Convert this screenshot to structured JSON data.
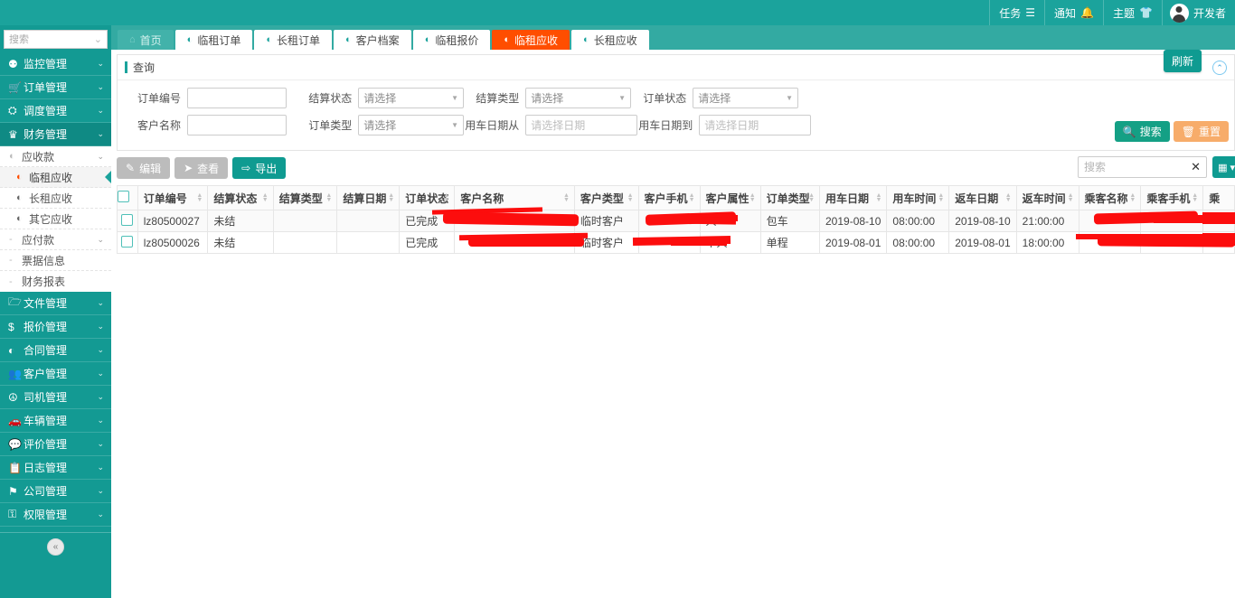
{
  "topbar": {
    "items": [
      {
        "label": "任务",
        "icon": "task-list-icon",
        "glyph": "☰"
      },
      {
        "label": "通知",
        "icon": "bell-icon",
        "glyph": "🔔"
      },
      {
        "label": "主题",
        "icon": "shirt-icon",
        "glyph": "👕"
      }
    ],
    "user": "开发者"
  },
  "sidebar": {
    "search_placeholder": "搜索",
    "chevron": "⌄",
    "collapse_glyph": "«",
    "menu": [
      {
        "label": "监控管理",
        "icon": "binoculars-icon",
        "glyph": "⚉",
        "arrow": "⌄"
      },
      {
        "label": "订单管理",
        "icon": "cart-icon",
        "glyph": "🛒",
        "arrow": "⌄"
      },
      {
        "label": "调度管理",
        "icon": "sitemap-icon",
        "glyph": "⛭",
        "arrow": "⌄"
      },
      {
        "label": "财务管理",
        "icon": "trophy-icon",
        "glyph": "♛",
        "arrow": "⌄",
        "open": true
      }
    ],
    "finance_children": [
      {
        "label": "应收款",
        "icon": "circle-half-icon",
        "glyph": "◐",
        "arrow": "⌄",
        "type": "group"
      },
      {
        "label": "临租应收",
        "icon": "circle-half-icon",
        "glyph": "◐",
        "type": "leaf",
        "active": true
      },
      {
        "label": "长租应收",
        "icon": "circle-half-icon",
        "glyph": "◐",
        "type": "leaf"
      },
      {
        "label": "其它应收",
        "icon": "circle-half-icon",
        "glyph": "◐",
        "type": "leaf"
      },
      {
        "label": "应付款",
        "icon": "dash-icon",
        "glyph": "-",
        "arrow": "⌄",
        "type": "group2"
      },
      {
        "label": "票据信息",
        "icon": "dash-icon",
        "glyph": "-",
        "type": "group2"
      },
      {
        "label": "财务报表",
        "icon": "dash-icon",
        "glyph": "-",
        "type": "group2"
      }
    ],
    "menu2": [
      {
        "label": "文件管理",
        "icon": "folder-icon",
        "glyph": "🗁",
        "arrow": "⌄"
      },
      {
        "label": "报价管理",
        "icon": "dollar-icon",
        "glyph": "$",
        "arrow": "⌄"
      },
      {
        "label": "合同管理",
        "icon": "circle-half-icon",
        "glyph": "◐",
        "arrow": "⌄"
      },
      {
        "label": "客户管理",
        "icon": "users-icon",
        "glyph": "👥",
        "arrow": "⌄"
      },
      {
        "label": "司机管理",
        "icon": "lifebuoy-icon",
        "glyph": "☮",
        "arrow": "⌄"
      },
      {
        "label": "车辆管理",
        "icon": "car-icon",
        "glyph": "🚗",
        "arrow": "⌄"
      },
      {
        "label": "评价管理",
        "icon": "comment-icon",
        "glyph": "💬",
        "arrow": "⌄"
      },
      {
        "label": "日志管理",
        "icon": "clipboard-icon",
        "glyph": "📋",
        "arrow": "⌄"
      },
      {
        "label": "公司管理",
        "icon": "flag-icon",
        "glyph": "⚑",
        "arrow": "⌄"
      },
      {
        "label": "权限管理",
        "icon": "keys-icon",
        "glyph": "⚿",
        "arrow": "⌄"
      }
    ]
  },
  "tabs": [
    {
      "label": "首页",
      "icon": "home-icon",
      "glyph": "⌂",
      "kind": "home"
    },
    {
      "label": "临租订单",
      "icon": "circle-half-icon",
      "glyph": "◐"
    },
    {
      "label": "长租订单",
      "icon": "circle-half-icon",
      "glyph": "◐"
    },
    {
      "label": "客户档案",
      "icon": "circle-half-icon",
      "glyph": "◐"
    },
    {
      "label": "临租报价",
      "icon": "circle-half-icon",
      "glyph": "◐"
    },
    {
      "label": "临租应收",
      "icon": "circle-half-icon",
      "glyph": "◐",
      "active": true
    },
    {
      "label": "长租应收",
      "icon": "circle-half-icon",
      "glyph": "◐"
    }
  ],
  "query_panel": {
    "title": "查询",
    "refresh_label": "刷新",
    "collapse_glyph": "⌃",
    "select_placeholder": "请选择",
    "date_placeholder": "请选择日期",
    "fields": {
      "order_no": "订单编号",
      "settle_status": "结算状态",
      "settle_type": "结算类型",
      "order_status": "订单状态",
      "customer_name": "客户名称",
      "order_type": "订单类型",
      "use_date_from": "用车日期从",
      "use_date_to": "用车日期到"
    },
    "values": {
      "order_no": "",
      "customer_name": "",
      "settle_status": "请选择",
      "settle_type": "请选择",
      "order_status": "请选择",
      "order_type": "请选择",
      "use_date_from": "请选择日期",
      "use_date_to": "请选择日期"
    },
    "search_label": "搜索",
    "reset_label": "重置",
    "search_icon_glyph": "🔍",
    "reset_icon_glyph": "🗑"
  },
  "toolbar": {
    "edit_label": "编辑",
    "edit_glyph": "✎",
    "view_label": "查看",
    "view_glyph": "➤",
    "export_label": "导出",
    "export_glyph": "⇨",
    "search_placeholder": "搜索",
    "search_value": "",
    "clear_glyph": "✕",
    "columns_glyph": "▦",
    "columns_caret": "▾"
  },
  "table": {
    "columns": [
      "订单编号",
      "结算状态",
      "结算类型",
      "结算日期",
      "订单状态",
      "客户名称",
      "客户类型",
      "客户手机",
      "客户属性",
      "订单类型",
      "用车日期",
      "用车时间",
      "返车日期",
      "返车时间",
      "乘客名称",
      "乘客手机",
      "乘"
    ],
    "rows": [
      {
        "订单编号": "lz80500027",
        "结算状态": "未结",
        "结算类型": "",
        "结算日期": "",
        "订单状态": "已完成",
        "客户名称": "",
        "客户类型": "临时客户",
        "客户手机": "",
        "客户属性": "人",
        "订单类型": "包车",
        "用车日期": "2019-08-10",
        "用车时间": "08:00:00",
        "返车日期": "2019-08-10",
        "返车时间": "21:00:00",
        "乘客名称": "",
        "乘客手机": "",
        "乘": ""
      },
      {
        "订单编号": "lz80500026",
        "结算状态": "未结",
        "结算类型": "",
        "结算日期": "",
        "订单状态": "已完成",
        "客户名称": "",
        "客户类型": "临时客户",
        "客户手机": "",
        "客户属性": "个人",
        "订单类型": "单程",
        "用车日期": "2019-08-01",
        "用车时间": "08:00:00",
        "返车日期": "2019-08-01",
        "返车时间": "18:00:00",
        "乘客名称": "",
        "乘客手机": "",
        "乘": ""
      }
    ]
  },
  "colors": {
    "brand": "#1ba39c",
    "sidebar": "#139a93",
    "active_tab": "#ff4e00",
    "reset": "#f7ac6a",
    "redaction": "#fc0d0d"
  }
}
